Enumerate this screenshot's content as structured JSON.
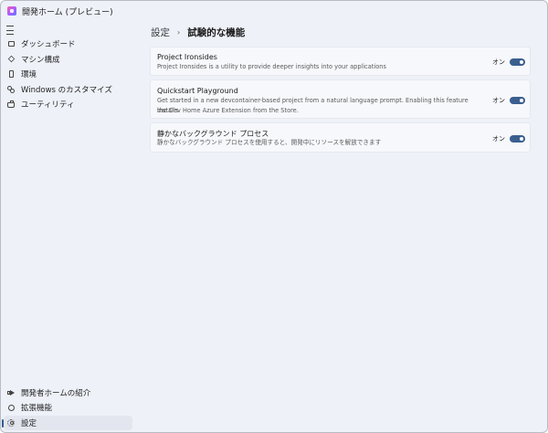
{
  "window": {
    "title": "開発ホーム (プレビュー)"
  },
  "sidebar": {
    "menu_icon": "hamburger-menu-icon",
    "items": [
      {
        "label": "ダッシュボード",
        "icon": "dashboard-icon"
      },
      {
        "label": "マシン構成",
        "icon": "machine-config-icon"
      },
      {
        "label": "環境",
        "icon": "environment-icon"
      },
      {
        "label": "Windows のカスタマイズ",
        "icon": "windows-customization-icon"
      },
      {
        "label": "ユーティリティ",
        "icon": "utilities-icon"
      }
    ],
    "footer_items": [
      {
        "label": "開発者ホームの紹介",
        "icon": "announcement-icon"
      },
      {
        "label": "拡張機能",
        "icon": "extensions-icon"
      },
      {
        "label": "設定",
        "icon": "gear-icon",
        "selected": true
      }
    ]
  },
  "breadcrumb": {
    "parent": "設定",
    "separator": "›",
    "current": "試験的な機能"
  },
  "features": [
    {
      "title": "Project Ironsides",
      "description": "Project Ironsides is a utility to provide deeper insights into your applications",
      "toggle_label": "オン",
      "enabled": true
    },
    {
      "title": "Quickstart Playground",
      "description_line1": "Get started in a new devcontainer-based project from a natural language prompt. Enabling this feature installs",
      "description_line2": "the Dev Home Azure Extension from the Store.",
      "toggle_label": "オン",
      "enabled": true
    },
    {
      "title": "静かなバックグラウンド プロセス",
      "description": "静かなバックグラウンド プロセスを使用すると、開発中にリソースを解放できます",
      "toggle_label": "オン",
      "enabled": true
    }
  ],
  "colors": {
    "accent": "#3a5f8f",
    "window_bg": "#eef1f8",
    "card_bg": "#f7f8fc"
  }
}
